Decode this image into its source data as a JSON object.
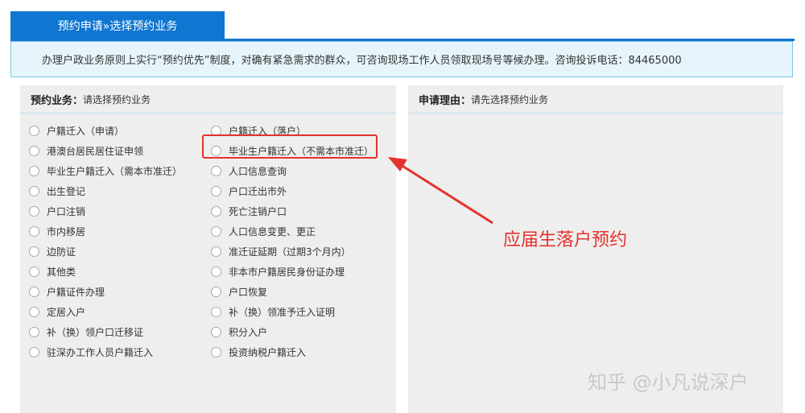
{
  "tab": {
    "label": "预约申请»选择预约业务"
  },
  "notice": {
    "text": "办理户政业务原则上实行“预约优先”制度，对确有紧急需求的群众，可咨询现场工作人员领取现场号等候办理。咨询投诉电话：84465000"
  },
  "left_panel": {
    "label": "预约业务：",
    "hint": "请选择预约业务",
    "options": [
      "户籍迁入（申请）",
      "户籍迁入（落户）",
      "港澳台居民居住证申领",
      "毕业生户籍迁入（不需本市准迁）",
      "毕业生户籍迁入（需本市准迁）",
      "人口信息查询",
      "出生登记",
      "户口迁出市外",
      "户口注销",
      "死亡注销户口",
      "市内移居",
      "人口信息变更、更正",
      "边防证",
      "准迁证延期（过期3个月内）",
      "其他类",
      "非本市户籍居民身份证办理",
      "户籍证件办理",
      "户口恢复",
      "定居入户",
      "补（换）领准予迁入证明",
      "补（换）领户口迁移证",
      "积分入户",
      "驻深办工作人员户籍迁入",
      "投资纳税户籍迁入"
    ]
  },
  "right_panel": {
    "label": "申请理由：",
    "hint": "请先选择预约业务"
  },
  "annotation": {
    "text": "应届生落户预约"
  },
  "watermark": {
    "text": "知乎 @小凡说深户"
  },
  "colors": {
    "accent": "#0f76d1",
    "highlight": "#e5322d"
  }
}
